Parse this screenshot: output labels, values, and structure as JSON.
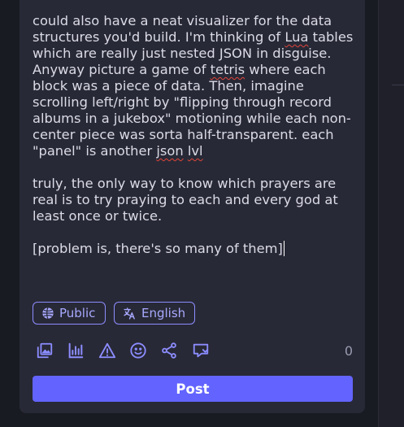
{
  "composer": {
    "paragraphs": [
      {
        "segments": [
          {
            "text": "could also have a neat visualizer for the data structures you'd build. I'm thinking of ",
            "misspelled": false
          },
          {
            "text": "Lua",
            "misspelled": true
          },
          {
            "text": " tables which are really just nested JSON in disguise. Anyway picture a game of ",
            "misspelled": false
          },
          {
            "text": "tetris",
            "misspelled": true
          },
          {
            "text": " where each block was a piece of data. Then, imagine scrolling left/right by \"flipping through record albums in a jukebox\" motioning while each non-center piece was sorta half-transparent. each \"panel\" is another ",
            "misspelled": false
          },
          {
            "text": "json",
            "misspelled": true
          },
          {
            "text": " ",
            "misspelled": false
          },
          {
            "text": "lvl",
            "misspelled": true
          }
        ]
      },
      {
        "segments": [
          {
            "text": "truly, the only way to know which prayers are real is to try praying to each and every god at least once or twice.",
            "misspelled": false
          }
        ]
      },
      {
        "segments": [
          {
            "text": "[problem is, there's so many of them]",
            "misspelled": false
          }
        ]
      }
    ],
    "visibility_label": "Public",
    "language_label": "English",
    "char_counter": "0",
    "post_label": "Post",
    "toolbar": [
      {
        "name": "media-icon",
        "label": "Add media"
      },
      {
        "name": "poll-icon",
        "label": "Add poll"
      },
      {
        "name": "content-warning-icon",
        "label": "Content warning"
      },
      {
        "name": "emoji-icon",
        "label": "Emoji"
      },
      {
        "name": "share-icon",
        "label": "Share"
      },
      {
        "name": "quote-icon",
        "label": "Quote"
      }
    ]
  },
  "colors": {
    "background": "#191b22",
    "panel": "#282936",
    "accent": "#6364ff",
    "pill_text": "#a8a9ff",
    "text": "#dadbe6",
    "spellcheck": "#e0453b"
  }
}
